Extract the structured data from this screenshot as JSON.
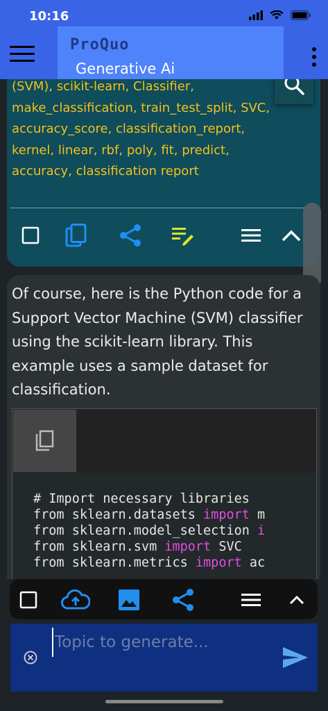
{
  "status_bar": {
    "time": "10:16"
  },
  "app_bar": {
    "title": "ProQuo",
    "subtitle": "Generative Ai"
  },
  "keywords_card": {
    "partial_top_line": "(SVM), scikit-learn, Classifier,",
    "text": "make_classification, train_test_split, SVC, accuracy_score, classification_report, kernel, linear, rbf, poly, fit, predict, accuracy, classification report"
  },
  "answer_card": {
    "text": "Of course, here is the Python code for a Support Vector Machine (SVM) classifier using the scikit-learn library. This example uses a sample dataset for classification.",
    "code": {
      "comment": "# Import necessary libraries",
      "lines": [
        {
          "from": "from sklearn.datasets ",
          "kw": "import",
          "rest": " m"
        },
        {
          "from": "from sklearn.model_selection ",
          "kw": "i",
          "rest": ""
        },
        {
          "from": "from sklearn.svm ",
          "kw": "import",
          "rest": " SVC"
        },
        {
          "from": "from sklearn.metrics ",
          "kw": "import",
          "rest": " ac"
        }
      ]
    }
  },
  "input": {
    "placeholder": "Topic to generate...",
    "value": ""
  },
  "colors": {
    "app_bar": "#3a64e6",
    "keyword_text": "#f2c21a",
    "accent_blue": "#1f8ff0",
    "code_keyword": "#e34de3"
  }
}
